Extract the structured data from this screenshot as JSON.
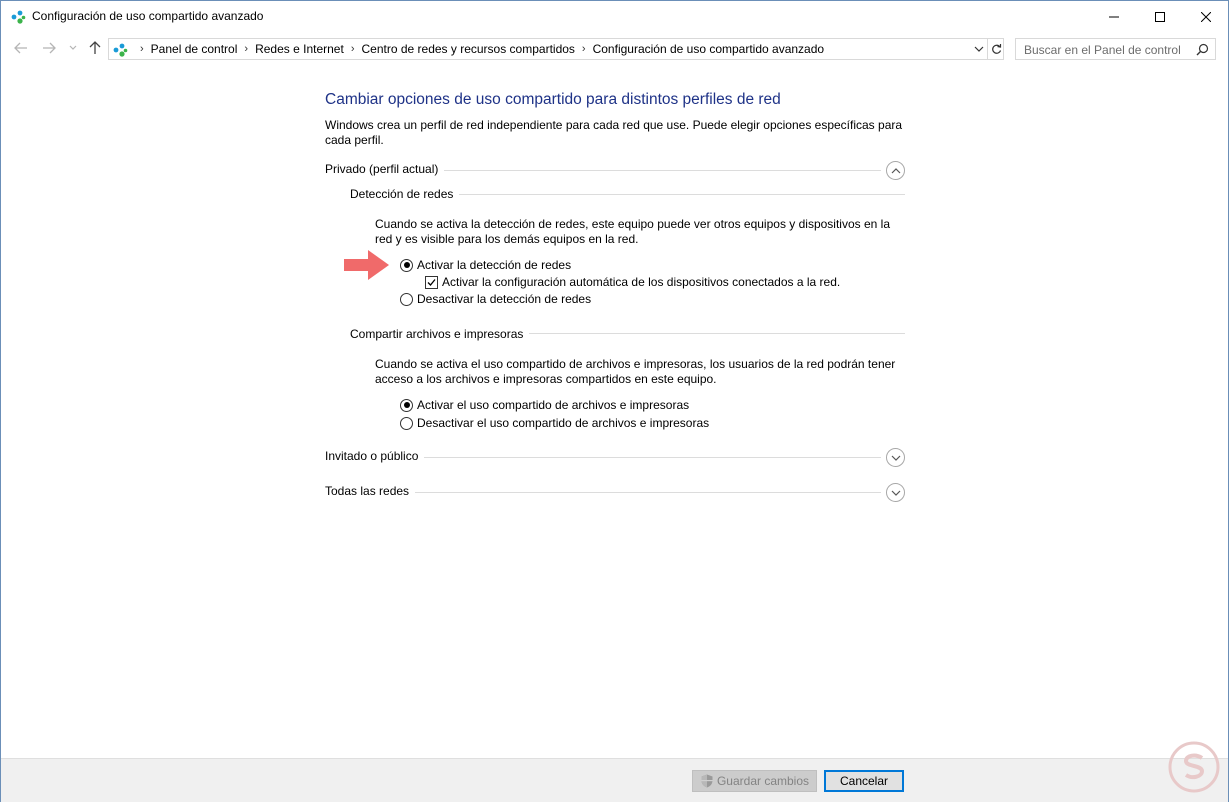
{
  "window": {
    "title": "Configuración de uso compartido avanzado",
    "controls": {
      "minimize_icon": "minimize-icon",
      "maximize_icon": "maximize-icon",
      "close_icon": "close-icon"
    }
  },
  "nav": {
    "breadcrumbs": [
      "Panel de control",
      "Redes e Internet",
      "Centro de redes y recursos compartidos",
      "Configuración de uso compartido avanzado"
    ],
    "search_placeholder": "Buscar en el Panel de control"
  },
  "main": {
    "title": "Cambiar opciones de uso compartido para distintos perfiles de red",
    "description": "Windows crea un perfil de red independiente para cada red que use. Puede elegir opciones específicas para cada perfil.",
    "profiles": [
      {
        "label": "Privado (perfil actual)",
        "expanded": true,
        "groups": [
          {
            "label": "Detección de redes",
            "description": "Cuando se activa la detección de redes, este equipo puede ver otros equipos y dispositivos en la red y es visible para los demás equipos en la red.",
            "option_on": "Activar la detección de redes",
            "sub_option": "Activar la configuración automática de los dispositivos conectados a la red.",
            "option_off": "Desactivar la detección de redes",
            "selected": "on",
            "sub_checked": true
          },
          {
            "label": "Compartir archivos e impresoras",
            "description": "Cuando se activa el uso compartido de archivos e impresoras, los usuarios de la red podrán tener acceso a los archivos e impresoras compartidos en este equipo.",
            "option_on": "Activar el uso compartido de archivos e impresoras",
            "option_off": "Desactivar el uso compartido de archivos e impresoras",
            "selected": "on"
          }
        ]
      },
      {
        "label": "Invitado o público",
        "expanded": false
      },
      {
        "label": "Todas las redes",
        "expanded": false
      }
    ]
  },
  "footer": {
    "save_label": "Guardar cambios",
    "save_enabled": false,
    "cancel_label": "Cancelar"
  },
  "colors": {
    "title_blue": "#1e3287",
    "arrow_red": "#f06a6a",
    "focus_blue": "#0078d7"
  }
}
